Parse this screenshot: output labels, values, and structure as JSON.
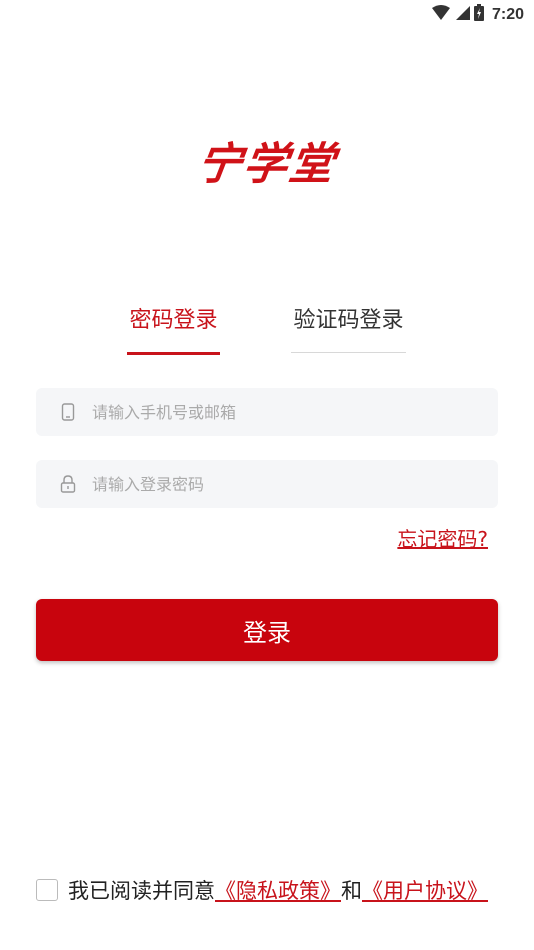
{
  "status_bar": {
    "time": "7:20",
    "icons": [
      "wifi-icon",
      "signal-icon",
      "battery-icon"
    ]
  },
  "logo": {
    "text": "宁学堂",
    "color": "#d01218"
  },
  "tabs": [
    {
      "label": "密码登录",
      "active": true
    },
    {
      "label": "验证码登录",
      "active": false
    }
  ],
  "form": {
    "phone_placeholder": "请输入手机号或邮箱",
    "phone_icon": "phone-icon",
    "password_placeholder": "请输入登录密码",
    "password_icon": "lock-icon",
    "forgot_password": "忘记密码?"
  },
  "login_button": {
    "label": "登录",
    "color": "#c8040d"
  },
  "agreement": {
    "prefix": "我已阅读并同意",
    "privacy_link": "《隐私政策》",
    "and": "和",
    "terms_link": "《用户协议》",
    "checked": false
  },
  "colors": {
    "accent": "#c8131b",
    "input_bg": "#f5f6f8",
    "placeholder": "#aaaaaa"
  }
}
